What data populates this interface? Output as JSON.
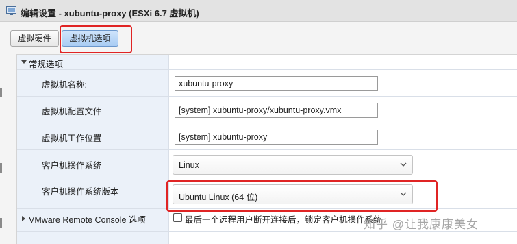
{
  "window": {
    "title": "编辑设置 - xubuntu-proxy (ESXi 6.7 虚拟机)"
  },
  "tabs": [
    {
      "label": "虚拟硬件",
      "active": false
    },
    {
      "label": "虚拟机选项",
      "active": true
    }
  ],
  "section": {
    "label": "常规选项"
  },
  "fields": {
    "vm_name": {
      "label": "虚拟机名称:",
      "value": "xubuntu-proxy"
    },
    "config_file": {
      "label": "虚拟机配置文件",
      "value": "[system] xubuntu-proxy/xubuntu-proxy.vmx"
    },
    "work_location": {
      "label": "虚拟机工作位置",
      "value": "[system] xubuntu-proxy"
    },
    "guest_os": {
      "label": "客户机操作系统",
      "value": "Linux"
    },
    "guest_os_version": {
      "label": "客户机操作系统版本",
      "value": "Ubuntu Linux (64 位)"
    }
  },
  "vmrc": {
    "label": "VMware Remote Console 选项",
    "checkbox_label": "最后一个远程用户断开连接后，锁定客户机操作系统",
    "checked": false
  },
  "watermark": "知乎 @让我康康美女",
  "colors": {
    "annotation": "#e02424",
    "active_tab": "#a9ccf3",
    "label_column": "#ebf1f9"
  }
}
